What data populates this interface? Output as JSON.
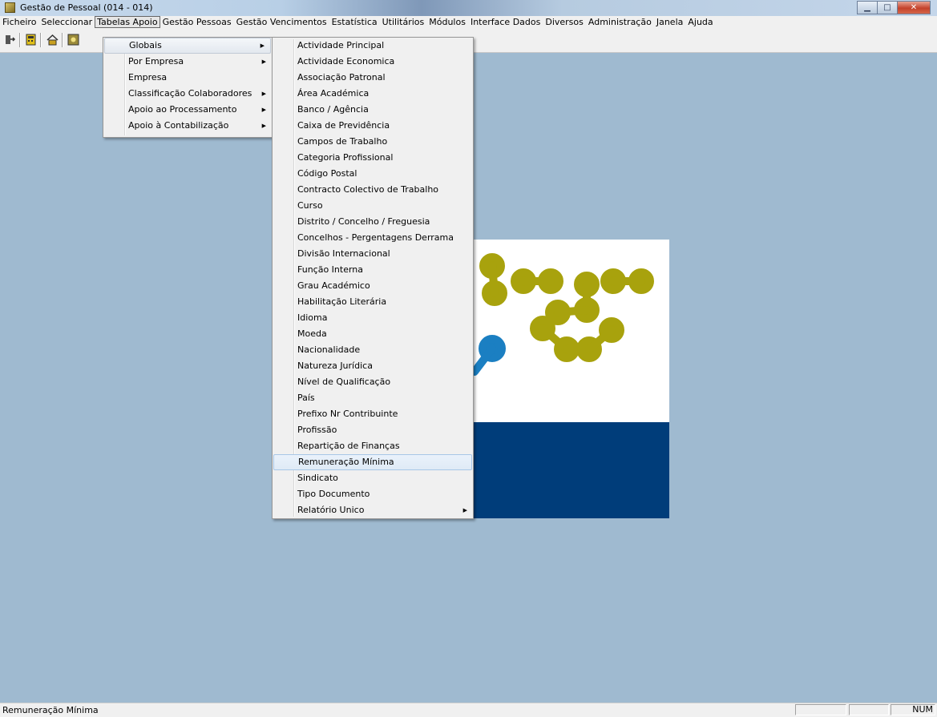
{
  "window": {
    "title": "Gestão de Pessoal (014 - 014)"
  },
  "menubar": [
    {
      "label": "Ficheiro"
    },
    {
      "label": "Seleccionar"
    },
    {
      "label": "Tabelas Apoio",
      "active": true
    },
    {
      "label": "Gestão Pessoas"
    },
    {
      "label": "Gestão Vencimentos"
    },
    {
      "label": "Estatística"
    },
    {
      "label": "Utilitários"
    },
    {
      "label": "Módulos"
    },
    {
      "label": "Interface Dados"
    },
    {
      "label": "Diversos"
    },
    {
      "label": "Administração"
    },
    {
      "label": "Janela"
    },
    {
      "label": "Ajuda"
    }
  ],
  "toolbar": {
    "icons": [
      "exit-icon",
      "calculator-icon",
      "home-icon",
      "app-icon"
    ]
  },
  "menu_tabelas_apoio": [
    {
      "label": "Globais",
      "submenu": true
    },
    {
      "label": "Por Empresa",
      "submenu": true
    },
    {
      "label": "Empresa",
      "submenu": false
    },
    {
      "label": "Classificação Colaboradores",
      "submenu": true
    },
    {
      "label": "Apoio ao Processamento",
      "submenu": true
    },
    {
      "label": "Apoio à Contabilização",
      "submenu": true
    }
  ],
  "menu_globais": [
    {
      "label": "Actividade Principal"
    },
    {
      "label": "Actividade Economica"
    },
    {
      "label": "Associação Patronal"
    },
    {
      "label": "Área Académica"
    },
    {
      "label": "Banco / Agência"
    },
    {
      "label": "Caixa de Previdência"
    },
    {
      "label": "Campos de Trabalho"
    },
    {
      "label": "Categoria Profissional"
    },
    {
      "label": "Código Postal"
    },
    {
      "label": "Contracto Colectivo de Trabalho"
    },
    {
      "label": "Curso"
    },
    {
      "label": "Distrito / Concelho / Freguesia"
    },
    {
      "label": "Concelhos - Pergentagens Derrama"
    },
    {
      "label": "Divisão Internacional"
    },
    {
      "label": "Função Interna"
    },
    {
      "label": "Grau Académico"
    },
    {
      "label": "Habilitação Literária"
    },
    {
      "label": "Idioma"
    },
    {
      "label": "Moeda"
    },
    {
      "label": "Nacionalidade"
    },
    {
      "label": "Natureza Jurídica"
    },
    {
      "label": "Nível de Qualificação"
    },
    {
      "label": "País"
    },
    {
      "label": "Prefixo Nr Contribuinte"
    },
    {
      "label": "Profissão"
    },
    {
      "label": "Repartição de Finanças"
    },
    {
      "label": "Remuneração Mínima",
      "highlighted": true
    },
    {
      "label": "Sindicato"
    },
    {
      "label": "Tipo Documento"
    },
    {
      "label": "Relatório Unico",
      "submenu": true
    }
  ],
  "statusbar": {
    "text": "Remuneração Mínima",
    "num": "NUM"
  },
  "colors": {
    "workspace": "#9fbad0",
    "logo_olive": "#a8a20d",
    "logo_blue": "#1b7fc2",
    "logo_navy": "#003d7a"
  }
}
